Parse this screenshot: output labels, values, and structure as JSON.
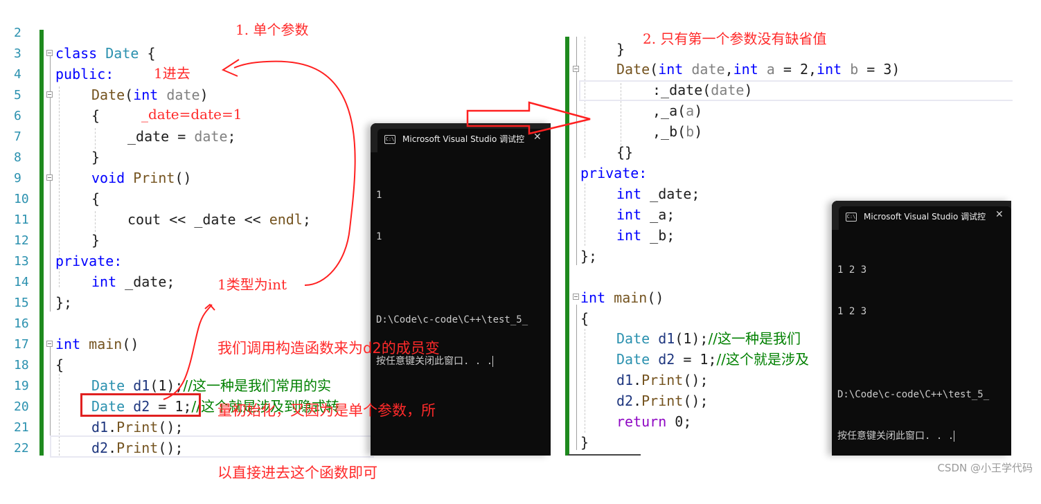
{
  "left_panel": {
    "line_numbers": [
      "2",
      "3",
      "4",
      "5",
      "6",
      "7",
      "8",
      "9",
      "10",
      "11",
      "12",
      "13",
      "14",
      "15",
      "16",
      "17",
      "18",
      "19",
      "20",
      "21",
      "22"
    ],
    "code": {
      "l3_kw": "class",
      "l3_type": "Date",
      "l3_rest": " {",
      "l4": "public:",
      "l5_fn": "Date",
      "l5_paren": "(",
      "l5_kw": "int",
      "l5_param": "date",
      "l5_close": ")",
      "l6": "{",
      "l7_var": "_date = ",
      "l7_param": "date",
      "l7_end": ";",
      "l8": "}",
      "l9_kw": "void",
      "l9_fn": "Print",
      "l9_rest": "()",
      "l10": "{",
      "l11_a": "cout << _date << ",
      "l11_fn": "endl",
      "l11_end": ";",
      "l12": "}",
      "l13": "private:",
      "l14_kw": "int",
      "l14_rest": " _date;",
      "l15": "};",
      "l17_kw": "int",
      "l17_fn": "main",
      "l17_rest": "()",
      "l18": "{",
      "l19_type": "Date",
      "l19_var": "d1",
      "l19_rest": "(1);",
      "l19_cm": "//这一种是我们常用的实",
      "l20_type": "Date",
      "l20_var": "d2",
      "l20_rest": " = 1;",
      "l20_cm": "//这个就是涉及到隐式转",
      "l21_var": "d1",
      "l21_dot": ".",
      "l21_fn": "Print",
      "l21_rest": "();",
      "l22_var": "d2",
      "l22_dot": ".",
      "l22_fn": "Print",
      "l22_rest": "();"
    },
    "annotations": {
      "title": "1. 单个参数",
      "enter": "1进去",
      "assign": "_date=date=1",
      "type_note": "1类型为int",
      "explain_1": "我们调用构造函数来为d2的成员变",
      "explain_2": "量初始化，又因为是单个参数，所",
      "explain_3": "以直接进去这个函数即可"
    },
    "console": {
      "title": "Microsoft Visual Studio 调试控",
      "close": "✕",
      "icon": "C:\\",
      "output": [
        "1",
        "1",
        "",
        "D:\\Code\\c-code\\C++\\test_5_",
        "按任意键关闭此窗口. . ."
      ]
    }
  },
  "right_panel": {
    "code": {
      "r1": "}",
      "r2_fn": "Date",
      "r2_p1": "(",
      "r2_kw1": "int",
      "r2_param1": " date",
      "r2_c1": ",",
      "r2_kw2": "int",
      "r2_param2": " a",
      "r2_eq1": " = 2,",
      "r2_kw3": "int",
      "r2_param3": " b",
      "r2_eq2": " = 3)",
      "r3_a": ":_date(",
      "r3_param": "date",
      "r3_b": ")",
      "r4_a": ",_a(",
      "r4_param": "a",
      "r4_b": ")",
      "r5_a": ",_b(",
      "r5_param": "b",
      "r5_b": ")",
      "r6": "{}",
      "r7": "private:",
      "r8_kw": "int",
      "r8_rest": " _date;",
      "r9_kw": "int",
      "r9_rest": " _a;",
      "r10_kw": "int",
      "r10_rest": " _b;",
      "r11": "};",
      "r13_kw": "int",
      "r13_fn": "main",
      "r13_rest": "()",
      "r14": "{",
      "r15_type": "Date",
      "r15_var": "d1",
      "r15_rest": "(1);",
      "r15_cm": "//这一种是我们",
      "r16_type": "Date",
      "r16_var": "d2",
      "r16_rest": " = 1;",
      "r16_cm": "//这个就是涉及",
      "r17_var": "d1",
      "r17_fn": "Print",
      "r17_rest": "();",
      "r18_var": "d2",
      "r18_fn": "Print",
      "r18_rest": "();",
      "r19_kw": "return",
      "r19_rest": " 0;",
      "r20": "}"
    },
    "annotations": {
      "title": "2. 只有第一个参数没有缺省值"
    },
    "console": {
      "title": "Microsoft Visual Studio 调试控",
      "close": "✕",
      "icon": "C:\\",
      "output": [
        "1 2 3",
        "1 2 3",
        "",
        "D:\\Code\\c-code\\C++\\test_5_",
        "按任意键关闭此窗口. . ."
      ]
    }
  },
  "watermark": "CSDN @小王学代码",
  "colors": {
    "annotation_red": "#ff2a2a",
    "change_bar_green": "#1e8a1e",
    "console_bg": "#0c0c0c"
  }
}
